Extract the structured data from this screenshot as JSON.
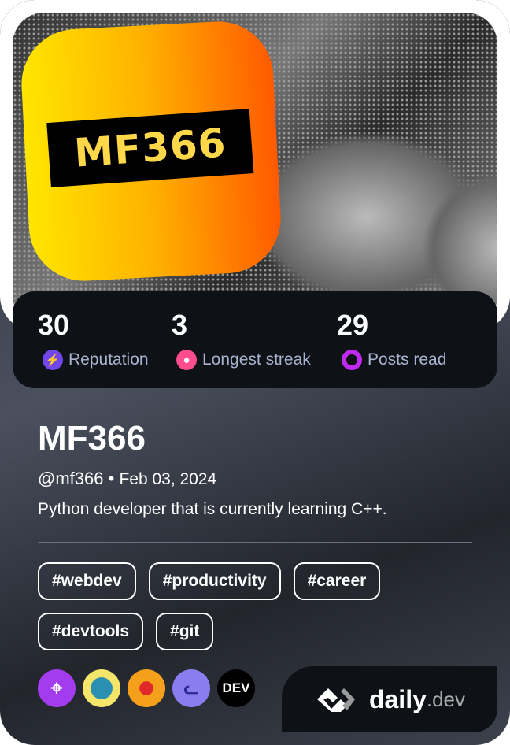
{
  "avatar": {
    "label": "MF366",
    "gradient": [
      "#ffe600",
      "#ff5a00"
    ]
  },
  "stats": [
    {
      "value": "30",
      "label": "Reputation",
      "icon": "lightning-icon",
      "color": "#7147ed"
    },
    {
      "value": "3",
      "label": "Longest streak",
      "icon": "flame-icon",
      "color": "#ff4d8d"
    },
    {
      "value": "29",
      "label": "Posts read",
      "icon": "ring-icon",
      "color": "#c029f0"
    }
  ],
  "profile": {
    "name": "MF366",
    "handle": "@mf366",
    "separator": "•",
    "joined": "Feb 03, 2024",
    "bio": "Python developer that is currently learning C++."
  },
  "tags": [
    "#webdev",
    "#productivity",
    "#career",
    "#devtools",
    "#git"
  ],
  "badges": [
    {
      "icon": "crosshair-icon",
      "color": "#a33bef"
    },
    {
      "icon": "robot-icon",
      "color": "#f3e66a"
    },
    {
      "icon": "boxing-glove-icon",
      "color": "#ffffff"
    },
    {
      "icon": "cat-icon",
      "color": "#8a7df0"
    },
    {
      "icon": "dev-logo-icon",
      "label": "DEV",
      "color": "#000000"
    }
  ],
  "brand": {
    "name": "daily",
    "suffix": ".dev"
  }
}
